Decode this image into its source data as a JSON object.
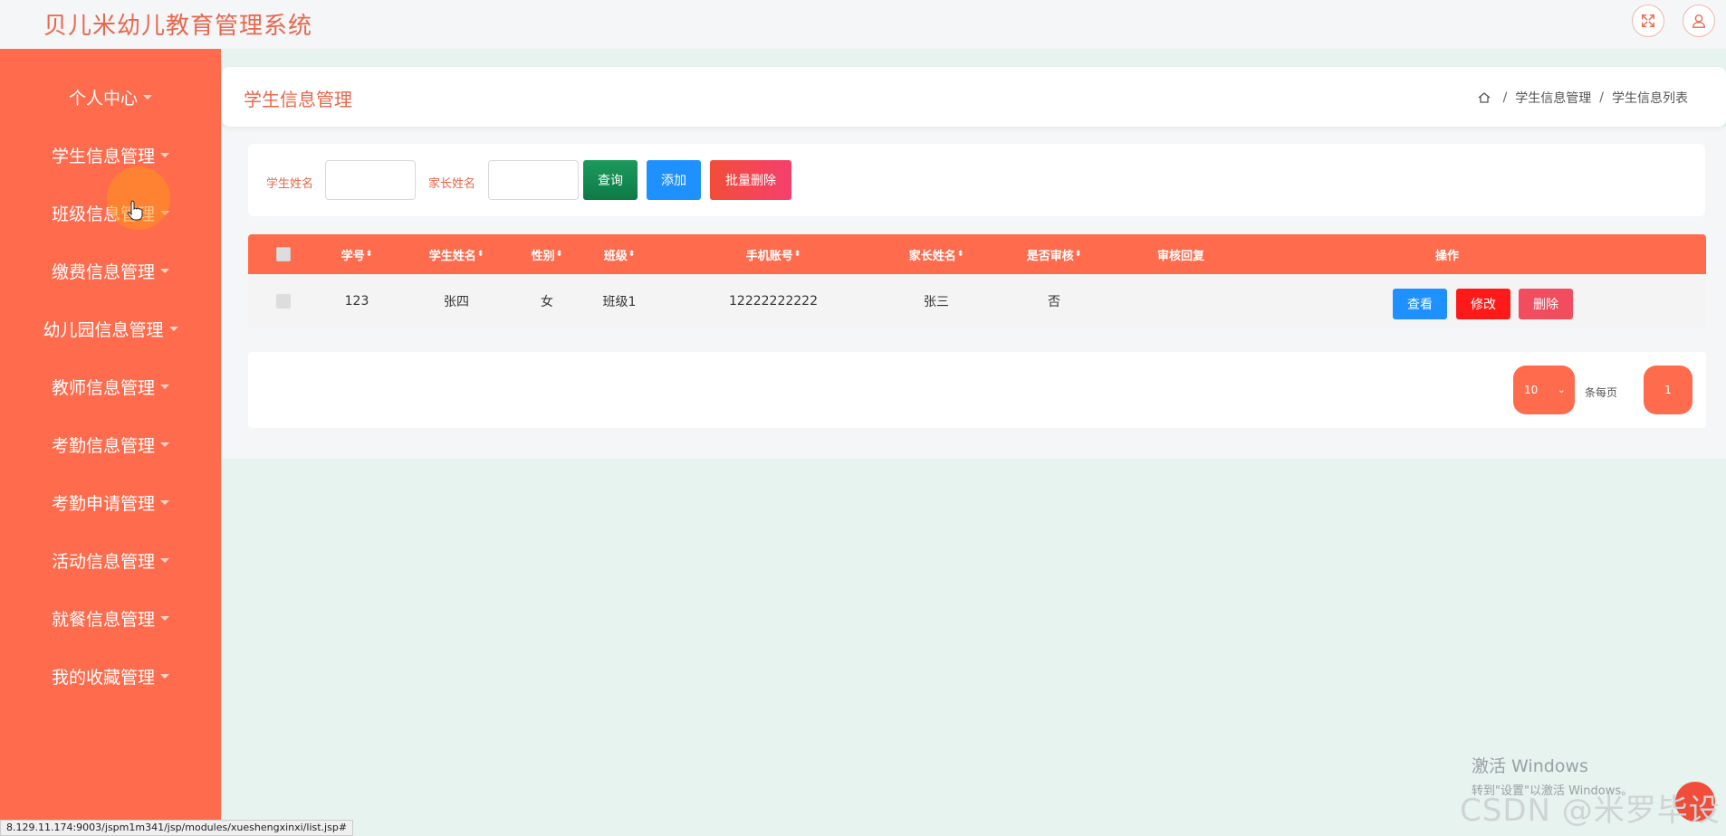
{
  "app": {
    "title": "贝儿米幼儿教育管理系统"
  },
  "topbar": {
    "fullscreen_icon": "fullscreen-icon",
    "user_icon": "user-icon"
  },
  "sidebar": {
    "items": [
      {
        "label": "个人中心"
      },
      {
        "label": "学生信息管理"
      },
      {
        "label": "班级信息管理"
      },
      {
        "label": "缴费信息管理"
      },
      {
        "label": "幼儿园信息管理"
      },
      {
        "label": "教师信息管理"
      },
      {
        "label": "考勤信息管理"
      },
      {
        "label": "考勤申请管理"
      },
      {
        "label": "活动信息管理"
      },
      {
        "label": "就餐信息管理"
      },
      {
        "label": "我的收藏管理"
      }
    ]
  },
  "header": {
    "title": "学生信息管理",
    "breadcrumb": [
      "学生信息管理",
      "学生信息列表"
    ]
  },
  "search": {
    "student_name_label": "学生姓名",
    "parent_name_label": "家长姓名",
    "student_name_value": "",
    "parent_name_value": "",
    "query_label": "查询",
    "add_label": "添加",
    "batch_delete_label": "批量删除"
  },
  "table": {
    "columns": [
      "学号",
      "学生姓名",
      "性别",
      "班级",
      "手机账号",
      "家长姓名",
      "是否审核",
      "审核回复",
      "操作"
    ],
    "sortable": [
      true,
      true,
      true,
      true,
      true,
      true,
      true,
      false,
      false
    ],
    "rows": [
      {
        "id": "123",
        "student_name": "张四",
        "gender": "女",
        "class": "班级1",
        "phone": "12222222222",
        "parent_name": "张三",
        "reviewed": "否",
        "review_reply": ""
      }
    ],
    "actions": {
      "view": "查看",
      "edit": "修改",
      "delete": "删除"
    }
  },
  "pagination": {
    "page_size": "10",
    "per_page_label": "条每页",
    "current_page": "1"
  },
  "statusbar": {
    "url": "8.129.11.174:9003/jspm1m341/jsp/modules/xueshengxinxi/list.jsp#"
  },
  "overlay": {
    "windows_activate_line1": "激活 Windows",
    "windows_activate_line2": "转到\"设置\"以激活 Windows。",
    "watermark": "CSDN @米罗毕设"
  },
  "colors": {
    "accent": "#ff6b4d",
    "title": "#e8674c",
    "query_btn": "#0e7a45",
    "add_btn": "#1e90ff",
    "view_btn": "#1e90ff",
    "edit_btn": "#ff1a1a",
    "delete_btn": "#f24d5e"
  }
}
